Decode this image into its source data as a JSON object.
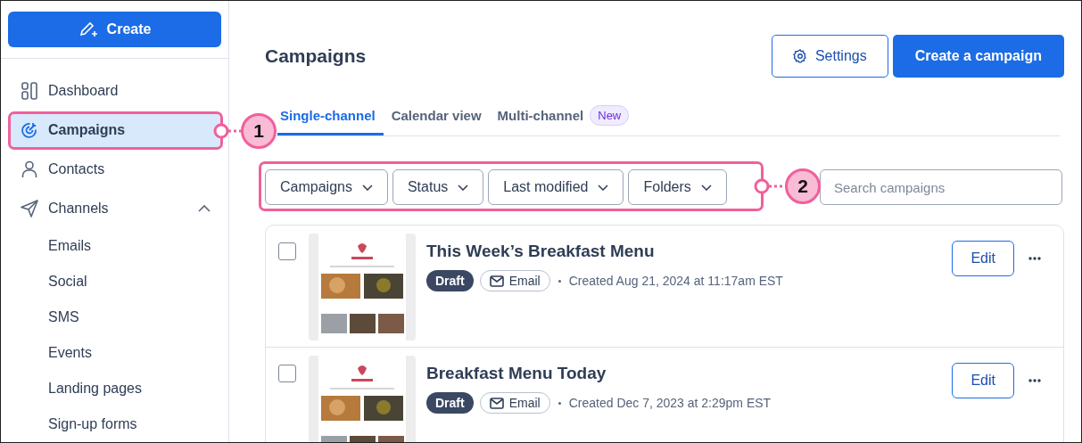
{
  "create_button": {
    "label": "Create"
  },
  "sidebar": {
    "items": [
      {
        "label": "Dashboard",
        "selected": false
      },
      {
        "label": "Campaigns",
        "selected": true
      },
      {
        "label": "Contacts",
        "selected": false
      },
      {
        "label": "Channels",
        "selected": false,
        "expanded": true,
        "children": [
          {
            "label": "Emails",
            "selected": false
          },
          {
            "label": "Social",
            "selected": false
          },
          {
            "label": "SMS",
            "selected": false
          },
          {
            "label": "Events",
            "selected": false
          },
          {
            "label": "Landing pages",
            "selected": false
          },
          {
            "label": "Sign-up forms",
            "selected": false
          }
        ]
      }
    ]
  },
  "header": {
    "title": "Campaigns",
    "settings_button": "Settings",
    "create_button": "Create a campaign"
  },
  "tabs": [
    {
      "label": "Single-channel",
      "selected": true
    },
    {
      "label": "Calendar view",
      "selected": false
    },
    {
      "label": "Multi-channel",
      "badge": "New",
      "selected": false
    }
  ],
  "filters": [
    "Campaigns",
    "Status",
    "Last modified",
    "Folders"
  ],
  "search": {
    "placeholder": "Search campaigns"
  },
  "campaigns": [
    {
      "title": "This Week’s Breakfast Menu",
      "status": "Draft",
      "channel": "Email",
      "created": "Created Aug 21, 2024 at 11:17am EST",
      "checked": false,
      "edit_button": "Edit"
    },
    {
      "title": "Breakfast Menu Today",
      "status": "Draft",
      "channel": "Email",
      "created": "Created Dec 7, 2023 at 2:29pm EST",
      "checked": false,
      "edit_button": "Edit"
    }
  ],
  "callouts": [
    {
      "number": "1"
    },
    {
      "number": "2"
    }
  ]
}
